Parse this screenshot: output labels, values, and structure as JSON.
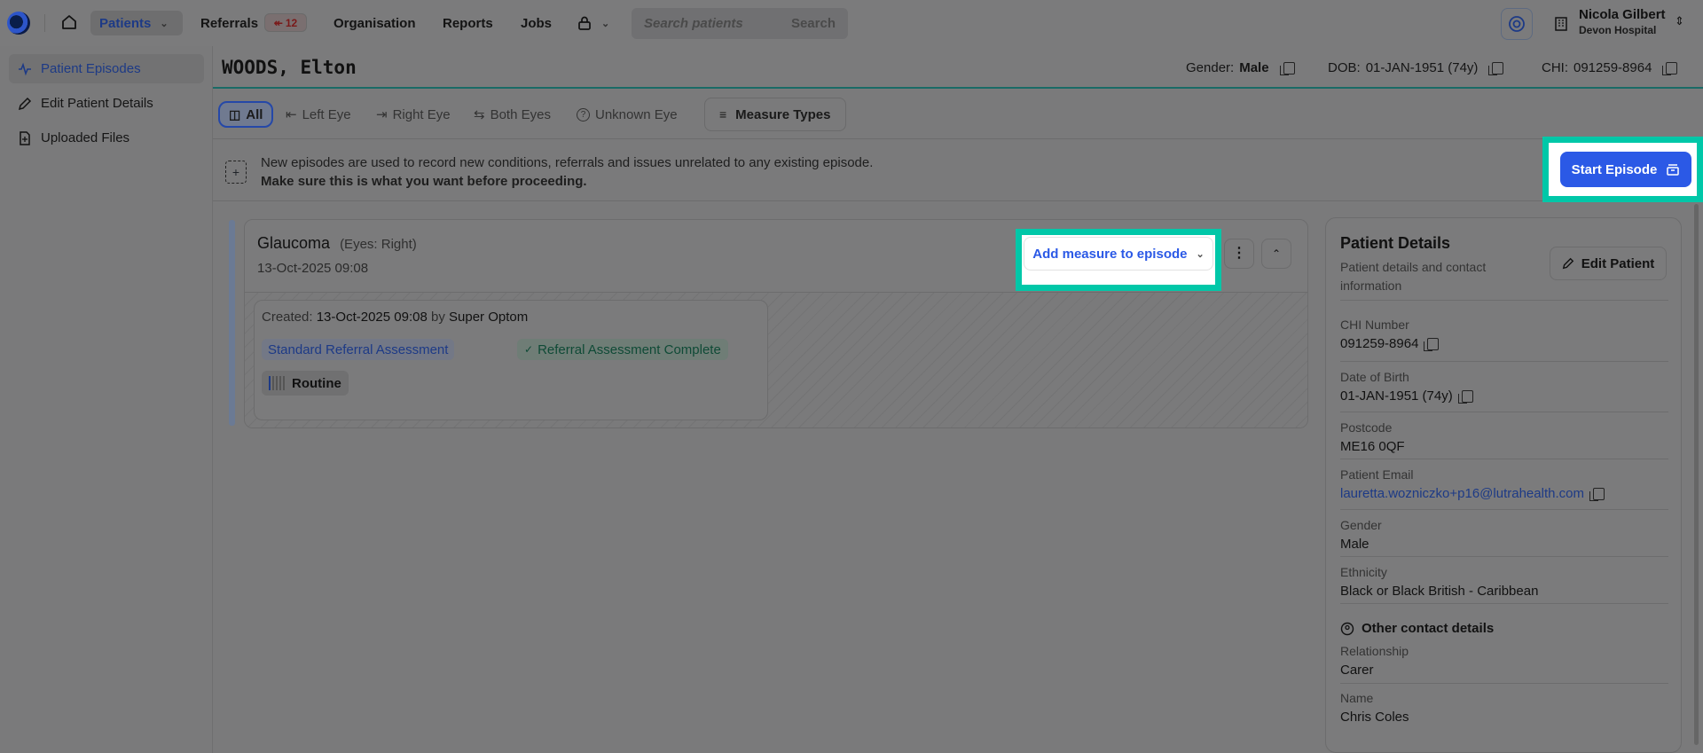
{
  "topbar": {
    "nav": {
      "patients": "Patients",
      "referrals": "Referrals",
      "referrals_count": "12",
      "organisation": "Organisation",
      "reports": "Reports",
      "jobs": "Jobs"
    },
    "search": {
      "placeholder": "Search patients",
      "button": "Search"
    },
    "user": {
      "name": "Nicola Gilbert",
      "org": "Devon Hospital"
    }
  },
  "sidebar": {
    "items": [
      {
        "label": "Patient Episodes",
        "icon": "activity-icon"
      },
      {
        "label": "Edit Patient Details",
        "icon": "pencil-icon"
      },
      {
        "label": "Uploaded Files",
        "icon": "file-icon"
      }
    ]
  },
  "patient": {
    "name": "WOODS, Elton",
    "gender_label": "Gender:",
    "gender": "Male",
    "dob_label": "DOB:",
    "dob": "01-JAN-1951 (74y)",
    "chi_label": "CHI:",
    "chi": "091259-8964"
  },
  "filters": {
    "all": "All",
    "left": "Left Eye",
    "right": "Right Eye",
    "both": "Both Eyes",
    "unknown": "Unknown Eye",
    "measure_types": "Measure Types"
  },
  "notice": {
    "line1": "New episodes are used to record new conditions, referrals and issues unrelated to any existing episode.",
    "line2": "Make sure this is what you want before proceeding.",
    "start_button": "Start Episode"
  },
  "episode": {
    "title": "Glaucoma",
    "eyes": "(Eyes: Right)",
    "date": "13-Oct-2025 09:08",
    "add_measure": "Add measure to episode",
    "created_label": "Created:",
    "created_date": "13-Oct-2025 09:08",
    "by": "by",
    "created_by": "Super Optom",
    "tag_assessment": "Standard Referral Assessment",
    "tag_complete": "Referral Assessment Complete",
    "priority": "Routine"
  },
  "details": {
    "title": "Patient Details",
    "subtitle": "Patient details and contact information",
    "edit_button": "Edit Patient",
    "chi_label": "CHI Number",
    "chi": "091259-8964",
    "dob_label": "Date of Birth",
    "dob": "01-JAN-1951 (74y)",
    "postcode_label": "Postcode",
    "postcode": "ME16 0QF",
    "email_label": "Patient Email",
    "email": "lauretta.wozniczko+p16@lutrahealth.com",
    "gender_label": "Gender",
    "gender": "Male",
    "ethnicity_label": "Ethnicity",
    "ethnicity": "Black or Black British - Caribbean",
    "other_heading": "Other contact details",
    "relationship_label": "Relationship",
    "relationship": "Carer",
    "contact_name_label": "Name",
    "contact_name": "Chris Coles"
  },
  "colors": {
    "accent": "#2b59e6",
    "highlight": "#00c7a8",
    "referral_badge": "#7a1919"
  }
}
